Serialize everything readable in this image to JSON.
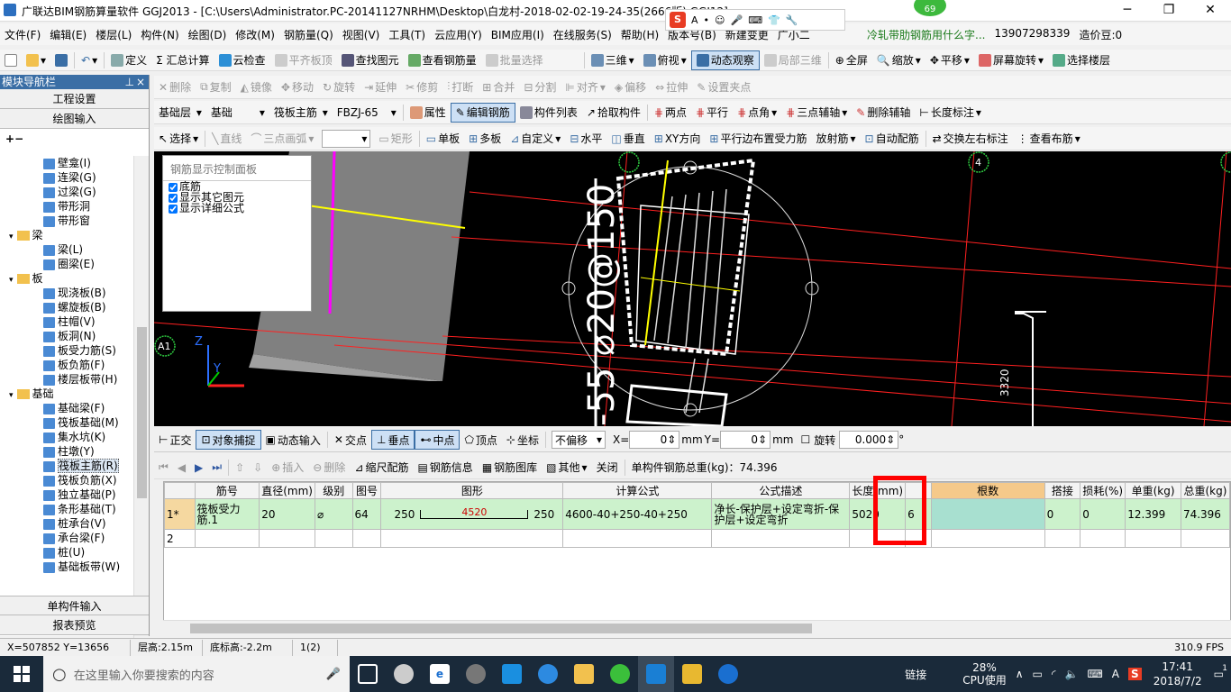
{
  "window": {
    "title": "广联达BIM钢筋算量软件 GGJ2013 - [C:\\Users\\Administrator.PC-20141127NRHM\\Desktop\\白龙村-2018-02-02-19-24-35(2666版).GGJ12]",
    "badge": "69",
    "minimize": "─",
    "maximize": "❐",
    "close": "✕"
  },
  "ime_bar": {
    "logo": "S",
    "mode": "A"
  },
  "menubar": {
    "items": [
      "文件(F)",
      "编辑(E)",
      "楼层(L)",
      "构件(N)",
      "绘图(D)",
      "修改(M)",
      "钢筋量(Q)",
      "视图(V)",
      "工具(T)",
      "云应用(Y)",
      "BIM应用(I)",
      "在线服务(S)",
      "帮助(H)",
      "版本号(B)",
      "新建变更",
      "广小二"
    ],
    "ad_text": "冷轧带肋钢筋用什么字...",
    "phone": "13907298339",
    "price": "造价豆:0"
  },
  "toolbar1": {
    "items": [
      "定义",
      "Σ 汇总计算",
      "云检查",
      "平齐板顶",
      "查找图元",
      "查看钢筋量",
      "批量选择",
      "三维",
      "俯视",
      "动态观察",
      "局部三维",
      "全屏",
      "缩放",
      "平移",
      "屏幕旋转",
      "选择楼层"
    ]
  },
  "toolbar2": {
    "items": [
      "删除",
      "复制",
      "镜像",
      "移动",
      "旋转",
      "延伸",
      "修剪",
      "打断",
      "合并",
      "分割",
      "对齐",
      "偏移",
      "拉伸",
      "设置夹点"
    ]
  },
  "toolbar3": {
    "floor": "基础层",
    "category": "基础",
    "member_type": "筏板主筋",
    "member_name": "FBZJ-65",
    "items": [
      "属性",
      "编辑钢筋",
      "构件列表",
      "拾取构件",
      "两点",
      "平行",
      "点角",
      "三点辅轴",
      "删除辅轴",
      "长度标注"
    ]
  },
  "toolbar4": {
    "items": [
      "选择",
      "直线",
      "三点画弧",
      "矩形",
      "单板",
      "多板",
      "自定义",
      "水平",
      "垂直",
      "XY方向",
      "平行边布置受力筋",
      "放射筋",
      "自动配筋",
      "交换左右标注",
      "查看布筋"
    ]
  },
  "nav": {
    "title": "模块导航栏",
    "pin": "⊥",
    "close": "×",
    "tab1": "工程设置",
    "tab2": "绘图输入",
    "bottom1": "单构件输入",
    "bottom2": "报表预览",
    "tree": [
      {
        "label": "壁龛(I)",
        "level": 2
      },
      {
        "label": "连梁(G)",
        "level": 2
      },
      {
        "label": "过梁(G)",
        "level": 2
      },
      {
        "label": "带形洞",
        "level": 2
      },
      {
        "label": "带形窗",
        "level": 2
      },
      {
        "label": "梁",
        "level": 1
      },
      {
        "label": "梁(L)",
        "level": 2
      },
      {
        "label": "圈梁(E)",
        "level": 2
      },
      {
        "label": "板",
        "level": 1
      },
      {
        "label": "现浇板(B)",
        "level": 2
      },
      {
        "label": "螺旋板(B)",
        "level": 2
      },
      {
        "label": "柱帽(V)",
        "level": 2
      },
      {
        "label": "板洞(N)",
        "level": 2
      },
      {
        "label": "板受力筋(S)",
        "level": 2
      },
      {
        "label": "板负筋(F)",
        "level": 2
      },
      {
        "label": "楼层板带(H)",
        "level": 2
      },
      {
        "label": "基础",
        "level": 1
      },
      {
        "label": "基础梁(F)",
        "level": 2
      },
      {
        "label": "筏板基础(M)",
        "level": 2
      },
      {
        "label": "集水坑(K)",
        "level": 2
      },
      {
        "label": "柱墩(Y)",
        "level": 2
      },
      {
        "label": "筏板主筋(R)",
        "level": 2
      },
      {
        "label": "筏板负筋(X)",
        "level": 2
      },
      {
        "label": "独立基础(P)",
        "level": 2
      },
      {
        "label": "条形基础(T)",
        "level": 2
      },
      {
        "label": "桩承台(V)",
        "level": 2
      },
      {
        "label": "承台梁(F)",
        "level": 2
      },
      {
        "label": "桩(U)",
        "level": 2
      },
      {
        "label": "基础板带(W)",
        "level": 2
      }
    ]
  },
  "rebar_panel": {
    "title": "钢筋显示控制面板",
    "options": [
      "底筋",
      "显示其它图元",
      "显示详细公式"
    ]
  },
  "canvas": {
    "axis_labels": [
      "A1",
      "4"
    ],
    "dimension": "3320",
    "rebar_text": "-55 ⌀20@150",
    "coord_z": "Z",
    "coord_y": "Y"
  },
  "snapbar": {
    "items": [
      "正交",
      "对象捕捉",
      "动态输入",
      "交点",
      "垂点",
      "中点",
      "顶点",
      "坐标"
    ],
    "offset_mode": "不偏移",
    "x_label": "X=",
    "x_value": "0",
    "y_label": "Y=",
    "y_value": "0",
    "unit": "mm",
    "rotate_label": "旋转",
    "rotate_value": "0.000",
    "degree": "°"
  },
  "table_toolbar": {
    "items": [
      "插入",
      "删除",
      "缩尺配筋",
      "钢筋信息",
      "钢筋图库",
      "其他",
      "关闭"
    ],
    "total_weight": "单构件钢筋总重(kg)：74.396"
  },
  "rebar_table": {
    "columns": [
      "",
      "筋号",
      "直径(mm)",
      "级别",
      "图号",
      "图形",
      "计算公式",
      "公式描述",
      "长度(mm)",
      "",
      "根数",
      "搭接",
      "损耗(%)",
      "单重(kg)",
      "总重(kg)"
    ],
    "rows": [
      {
        "idx": "1*",
        "name": "筏板受力筋.1",
        "diameter": "20",
        "grade": "⌀",
        "fig": "64",
        "shape_left": "250",
        "shape_mid": "4520",
        "shape_right": "250",
        "formula": "4600-40+250-40+250",
        "desc": "净长-保护层+设定弯折-保护层+设定弯折",
        "length": "5020",
        "extra": "6",
        "count": "",
        "lap": "0",
        "loss": "0",
        "unit_weight": "12.399",
        "total_weight": "74.396"
      },
      {
        "idx": "2",
        "name": "",
        "diameter": "",
        "grade": "",
        "fig": "",
        "shape_left": "",
        "shape_mid": "",
        "shape_right": "",
        "formula": "",
        "desc": "",
        "length": "",
        "extra": "",
        "count": "",
        "lap": "",
        "loss": "",
        "unit_weight": "",
        "total_weight": ""
      }
    ]
  },
  "statusbar": {
    "coords": "X=507852 Y=13656",
    "floor_height": "层高:2.15m",
    "base_height": "底标高:-2.2m",
    "count": "1(2)",
    "fps": "310.9 FPS"
  },
  "taskbar": {
    "search_placeholder": "在这里输入你要搜索的内容",
    "link": "链接",
    "cpu_percent": "28%",
    "cpu_label": "CPU使用",
    "time": "17:41",
    "date": "2018/7/2",
    "ime": "A",
    "notif": "1"
  },
  "colors": {
    "nav_header": "#3a6ea5",
    "grid_row_highlight": "#ccf2cc",
    "count_header": "#f5c98a",
    "count_cell": "#a8e0d0",
    "redbox": "#ff0000"
  }
}
